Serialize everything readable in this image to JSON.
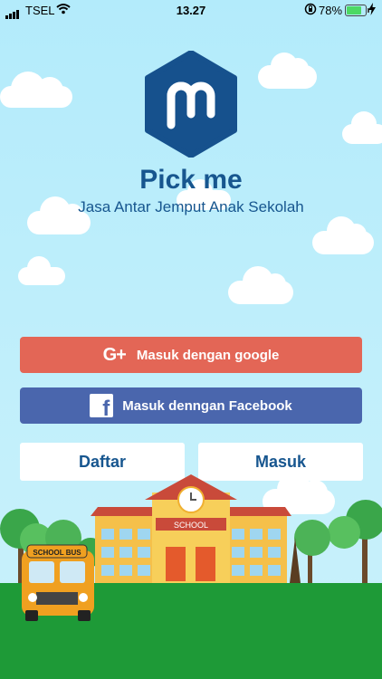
{
  "status_bar": {
    "carrier": "TSEL",
    "time": "13.27",
    "battery": "78%"
  },
  "app": {
    "title": "Pick me",
    "subtitle": "Jasa Antar Jemput Anak Sekolah"
  },
  "buttons": {
    "google": "Masuk dengan google",
    "facebook": "Masuk denngan Facebook",
    "register": "Daftar",
    "login": "Masuk"
  },
  "illustration": {
    "school_sign": "SCHOOL",
    "bus_sign": "SCHOOL BUS"
  },
  "colors": {
    "sky": "#bfeefa",
    "brand": "#17568f",
    "google": "#e36656",
    "facebook": "#4a66ad",
    "grass": "#1e9a37"
  },
  "icons": [
    "signal-icon",
    "wifi-icon",
    "orientation-lock-icon",
    "battery-icon",
    "charging-icon",
    "google-plus-icon",
    "facebook-icon"
  ]
}
